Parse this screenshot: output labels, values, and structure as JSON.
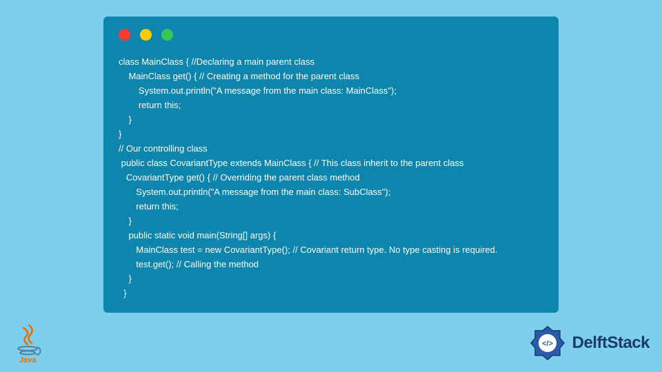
{
  "code": {
    "lines": [
      "class MainClass { //Declaring a main parent class",
      "    MainClass get() { // Creating a method for the parent class",
      "        System.out.println(\"A message from the main class: MainClass\");",
      "        return this;",
      "    }",
      "}",
      "// Our controlling class",
      " public class CovariantType extends MainClass { // This class inherit to the parent class",
      "   CovariantType get() { // Overriding the parent class method",
      "       System.out.println(\"A message from the main class: SubClass\");",
      "       return this;",
      "    }",
      "    public static void main(String[] args) {",
      "       MainClass test = new CovariantType(); // Covariant return type. No type casting is required.",
      "       test.get(); // Calling the method",
      "    }",
      "  }"
    ]
  },
  "branding": {
    "java_label": "Java",
    "delft_label": "DelftStack"
  }
}
